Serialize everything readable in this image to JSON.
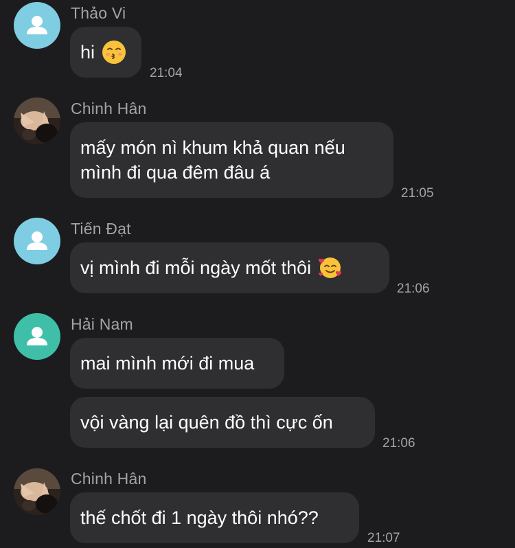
{
  "messages": [
    {
      "sender": "Thảo Vi",
      "text": "hi",
      "emoji": "kissing-face-emoji",
      "time": "21:04"
    },
    {
      "sender": "Chinh Hân",
      "text": "mấy món nì khum khả quan nếu\nmình đi qua đêm đâu á",
      "time": "21:05"
    },
    {
      "sender": "Tiến Đạt",
      "text": "vị mình đi mỗi ngày mốt thôi",
      "emoji": "smiling-face-with-hearts-emoji",
      "time": "21:06"
    },
    {
      "sender": "Hải Nam",
      "text": "mai mình mới đi mua"
    },
    {
      "text": "vội vàng lại quên đồ thì cực ốn",
      "time": "21:06"
    },
    {
      "sender": "Chinh Hân",
      "text": "thế chốt đi 1 ngày thôi nhó??",
      "time": "21:07"
    }
  ],
  "colors": {
    "background": "#1c1c1e",
    "bubble": "#2f2f31",
    "meta_text": "#a3a3a8",
    "avatar_blue": "#7fcde3",
    "avatar_teal": "#3fbfa8"
  }
}
